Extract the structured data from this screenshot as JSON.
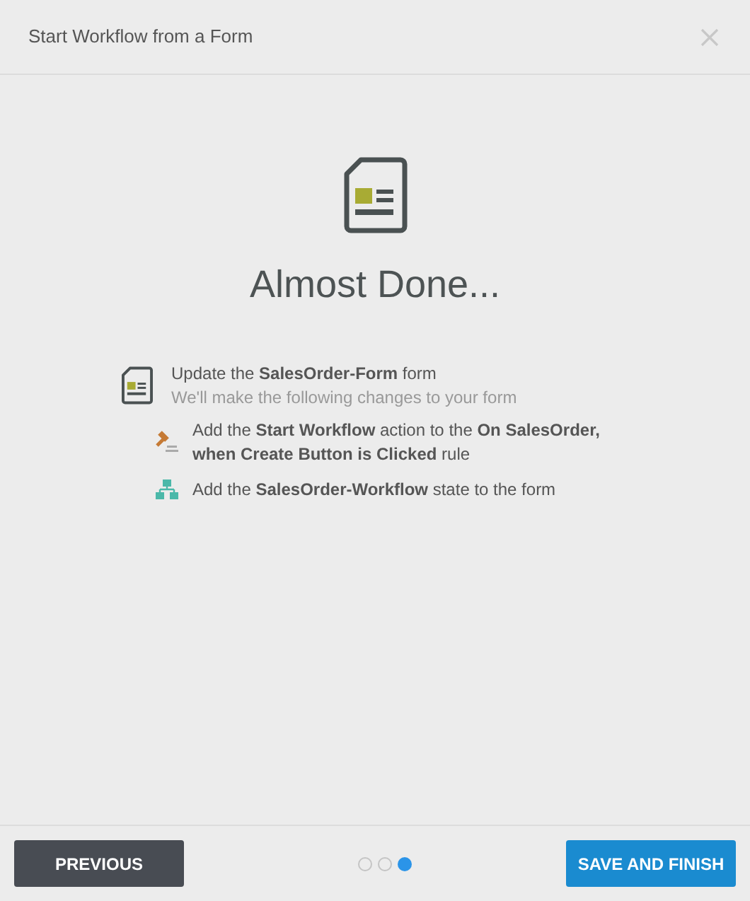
{
  "dialog": {
    "title": "Start Workflow from a Form"
  },
  "heading": "Almost Done...",
  "summary": {
    "title": "Update the **SalesOrder-Form** form",
    "subtitle": "We'll make the following changes to your form",
    "changes": [
      {
        "kind": "rule",
        "text": "Add the **Start Workflow** action to the **On SalesOrder, when Create Button is Clicked** rule"
      },
      {
        "kind": "state",
        "text": "Add the **SalesOrder-Workflow** state to the form"
      }
    ]
  },
  "footer": {
    "previous": "PREVIOUS",
    "finish": "SAVE AND FINISH",
    "steps": [
      {
        "selected": false
      },
      {
        "selected": false
      },
      {
        "selected": true
      }
    ]
  }
}
